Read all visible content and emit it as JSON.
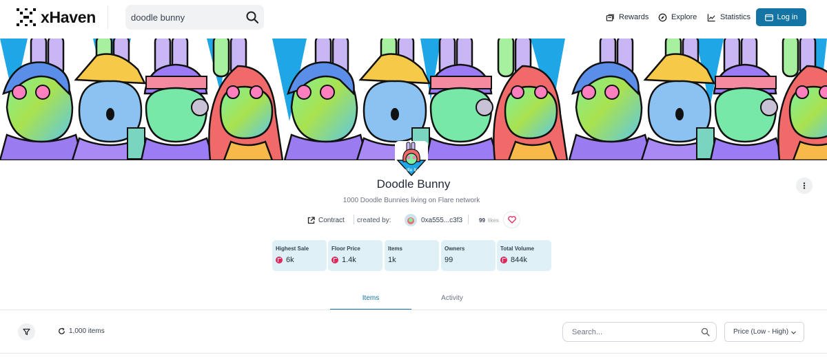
{
  "app": {
    "name": "xHaven"
  },
  "header": {
    "search_value": "doodle bunny",
    "nav": {
      "rewards": "Rewards",
      "explore": "Explore",
      "statistics": "Statistics"
    },
    "login_label": "Log in",
    "accent_color": "#1474a4"
  },
  "collection": {
    "name": "Doodle Bunny",
    "description": "1000 Doodle Bunnies living on Flare network",
    "contract_label": "Contract",
    "created_by_label": "created by:",
    "creator_address": "0xa555...c3f3",
    "likes_count": "99",
    "likes_label": "likes"
  },
  "stats": [
    {
      "label": "Highest Sale",
      "value": "6k",
      "token_icon": "flare-icon"
    },
    {
      "label": "Floor Price",
      "value": "1.4k",
      "token_icon": "flare-icon"
    },
    {
      "label": "Items",
      "value": "1k"
    },
    {
      "label": "Owners",
      "value": "99"
    },
    {
      "label": "Total Volume",
      "value": "844k",
      "token_icon": "flare-icon"
    }
  ],
  "tabs": [
    {
      "label": "Items",
      "active": true
    },
    {
      "label": "Activity",
      "active": false
    }
  ],
  "toolbar": {
    "items_count": "1,000 items",
    "search_placeholder": "Search...",
    "sort_selected": "Price (Low - High)"
  },
  "colors": {
    "stat_bg": "#dff1f7",
    "flare_red": "#e0285a",
    "banner_sky": "#1fa6e6"
  }
}
